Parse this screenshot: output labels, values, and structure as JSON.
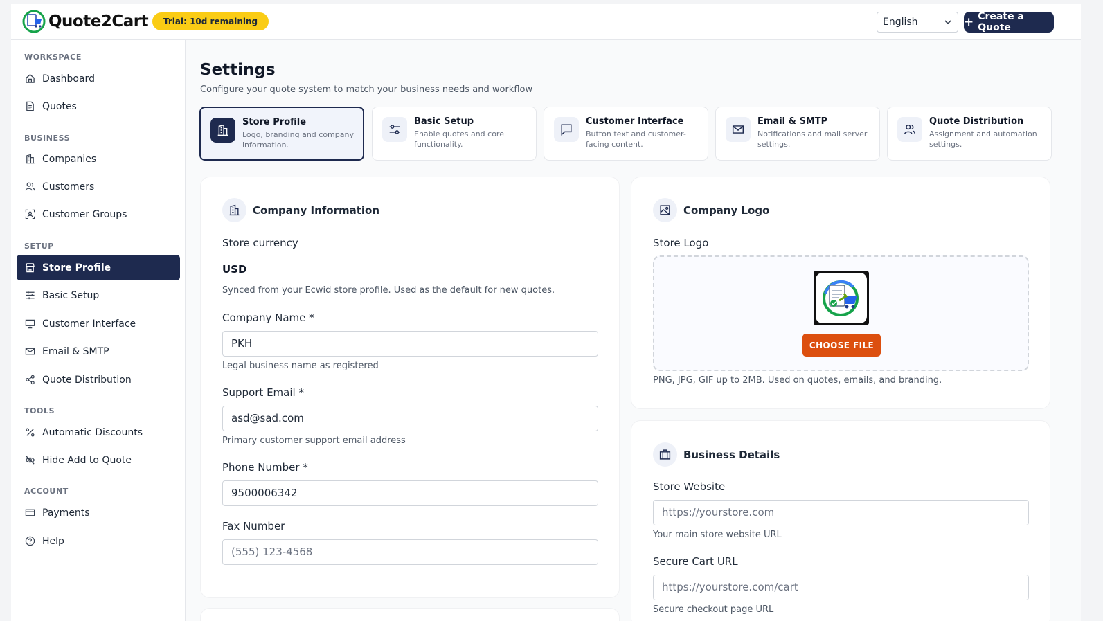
{
  "header": {
    "brand": "Quote2Cart",
    "trial_badge": "Trial: 10d remaining",
    "language": "English",
    "create_button": "Create a Quote"
  },
  "sidebar": {
    "sections": [
      {
        "title": "WORKSPACE",
        "items": [
          {
            "label": "Dashboard",
            "icon": "home-icon"
          },
          {
            "label": "Quotes",
            "icon": "document-icon"
          }
        ]
      },
      {
        "title": "BUSINESS",
        "items": [
          {
            "label": "Companies",
            "icon": "building-icon"
          },
          {
            "label": "Customers",
            "icon": "users-icon"
          },
          {
            "label": "Customer Groups",
            "icon": "group-icon"
          }
        ]
      },
      {
        "title": "SETUP",
        "items": [
          {
            "label": "Store Profile",
            "icon": "store-icon",
            "active": true
          },
          {
            "label": "Basic Setup",
            "icon": "sliders-icon"
          },
          {
            "label": "Customer Interface",
            "icon": "monitor-icon"
          },
          {
            "label": "Email & SMTP",
            "icon": "mail-icon"
          },
          {
            "label": "Quote Distribution",
            "icon": "share-icon"
          }
        ]
      },
      {
        "title": "TOOLS",
        "items": [
          {
            "label": "Automatic Discounts",
            "icon": "percent-icon"
          },
          {
            "label": "Hide Add to Quote",
            "icon": "eye-off-icon"
          }
        ]
      },
      {
        "title": "ACCOUNT",
        "items": [
          {
            "label": "Payments",
            "icon": "card-icon"
          },
          {
            "label": "Help",
            "icon": "help-icon"
          }
        ]
      }
    ]
  },
  "page": {
    "title": "Settings",
    "subtitle": "Configure your quote system to match your business needs and workflow"
  },
  "tabs": [
    {
      "title": "Store Profile",
      "desc": "Logo, branding and company information.",
      "icon": "building-icon",
      "active": true
    },
    {
      "title": "Basic Setup",
      "desc": "Enable quotes and core functionality.",
      "icon": "sliders-icon"
    },
    {
      "title": "Customer Interface",
      "desc": "Button text and customer-facing content.",
      "icon": "chat-icon"
    },
    {
      "title": "Email & SMTP",
      "desc": "Notifications and mail server settings.",
      "icon": "mail-icon"
    },
    {
      "title": "Quote Distribution",
      "desc": "Assignment and automation settings.",
      "icon": "users-icon"
    }
  ],
  "company_info": {
    "heading": "Company Information",
    "currency_label": "Store currency",
    "currency_value": "USD",
    "currency_help": "Synced from your Ecwid store profile. Used as the default for new quotes.",
    "company_name_label": "Company Name *",
    "company_name_value": "PKH",
    "company_name_help": "Legal business name as registered",
    "support_email_label": "Support Email *",
    "support_email_value": "asd@sad.com",
    "support_email_help": "Primary customer support email address",
    "phone_label": "Phone Number *",
    "phone_value": "9500006342",
    "fax_label": "Fax Number",
    "fax_placeholder": "(555) 123-4568"
  },
  "company_logo": {
    "heading": "Company Logo",
    "store_logo_label": "Store Logo",
    "choose_button": "CHOOSE FILE",
    "help": "PNG, JPG, GIF up to 2MB. Used on quotes, emails, and branding."
  },
  "business_details": {
    "heading": "Business Details",
    "website_label": "Store Website",
    "website_placeholder": "https://yourstore.com",
    "website_help": "Your main store website URL",
    "cart_label": "Secure Cart URL",
    "cart_placeholder": "https://yourstore.com/cart",
    "cart_help": "Secure checkout page URL"
  },
  "colors": {
    "primary": "#1e2a4f",
    "trial": "#facc15",
    "choose": "#dc4f0f"
  }
}
